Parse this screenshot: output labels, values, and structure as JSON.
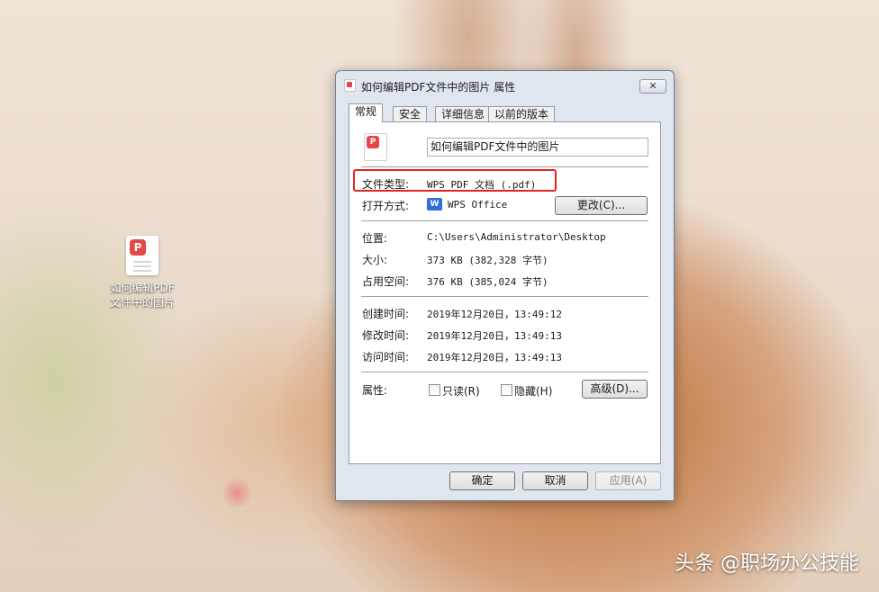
{
  "desktop": {
    "file_icon_label_line1": "如何编辑PDF",
    "file_icon_label_line2": "文件中的图片"
  },
  "dialog": {
    "title": "如何编辑PDF文件中的图片 属性",
    "close_glyph": "✕",
    "tabs": [
      "常规",
      "安全",
      "详细信息",
      "以前的版本"
    ],
    "active_tab": "常规",
    "file_name": "如何编辑PDF文件中的图片",
    "file_type_label": "文件类型:",
    "file_type_value": "WPS PDF 文档 (.pdf)",
    "open_with_label": "打开方式:",
    "open_with_value": "WPS Office",
    "open_with_icon": "wps-icon",
    "change_button": "更改(C)...",
    "location_label": "位置:",
    "location_value": "C:\\Users\\Administrator\\Desktop",
    "size_label": "大小:",
    "size_value": "373 KB (382,328 字节)",
    "size_on_disk_label": "占用空间:",
    "size_on_disk_value": "376 KB (385,024 字节)",
    "created_label": "创建时间:",
    "created_value": "2019年12月20日，13:49:12",
    "modified_label": "修改时间:",
    "modified_value": "2019年12月20日，13:49:13",
    "accessed_label": "访问时间:",
    "accessed_value": "2019年12月20日，13:49:13",
    "attributes_label": "属性:",
    "readonly_label": "只读(R)",
    "readonly_checked": false,
    "hidden_label": "隐藏(H)",
    "hidden_checked": false,
    "advanced_button": "高级(D)...",
    "ok_button": "确定",
    "cancel_button": "取消",
    "apply_button": "应用(A)",
    "highlight_color": "#e02323"
  },
  "watermark": "头条 @职场办公技能"
}
